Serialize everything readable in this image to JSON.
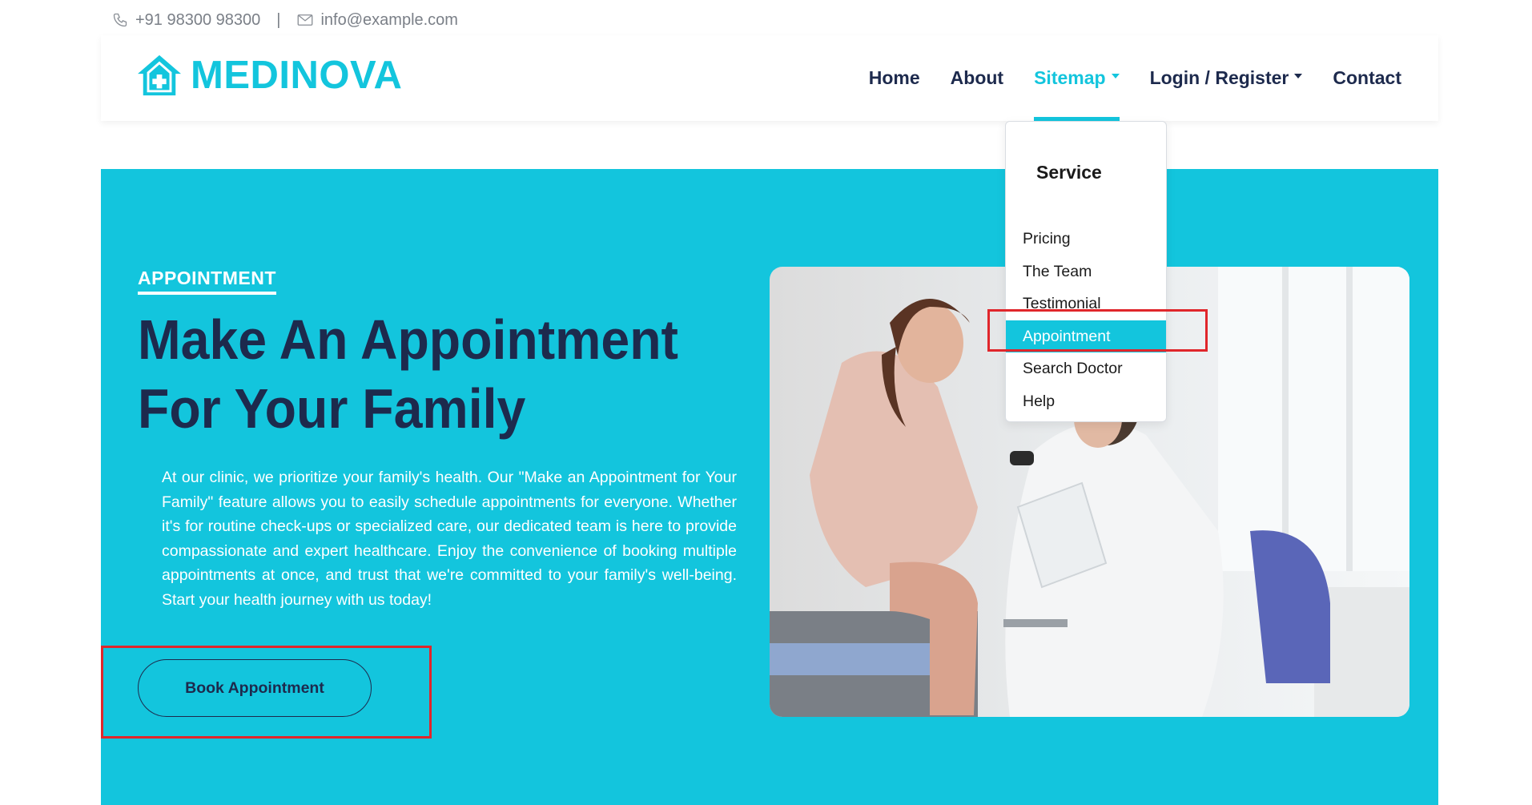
{
  "topbar": {
    "phone": "+91 98300 98300",
    "separator": "|",
    "email": "info@example.com",
    "phone_icon": "phone-icon",
    "email_icon": "envelope-icon"
  },
  "brand": {
    "name": "MEDINOVA",
    "icon": "house-medical-icon",
    "color": "#13c5dd"
  },
  "nav": {
    "items": [
      {
        "label": "Home"
      },
      {
        "label": "About"
      },
      {
        "label": "Sitemap"
      },
      {
        "label": "Login / Register"
      },
      {
        "label": "Contact"
      }
    ],
    "active": "Sitemap"
  },
  "dropdown": {
    "title": "Service",
    "items": [
      {
        "label": "Pricing"
      },
      {
        "label": "The Team"
      },
      {
        "label": "Testimonial"
      },
      {
        "label": "Appointment"
      },
      {
        "label": "Search Doctor"
      },
      {
        "label": "Help"
      }
    ],
    "highlighted": "Appointment"
  },
  "hero": {
    "eyebrow": "APPOINTMENT",
    "headline": "Make An Appointment For Your Family",
    "description": "At our clinic, we prioritize your family's health. Our \"Make an Appointment for Your Family\" feature allows you to easily schedule appointments for everyone. Whether it's for routine check-ups or specialized care, our dedicated team is here to provide compassionate and expert healthcare. Enjoy the convenience of booking multiple appointments at once, and trust that we're committed to your family's well-being. Start your health journey with us today!",
    "cta": "Book Appointment",
    "background_color": "#13c5dd",
    "text_color": "#1d2a4d"
  },
  "annotation_color": "#e0262b"
}
